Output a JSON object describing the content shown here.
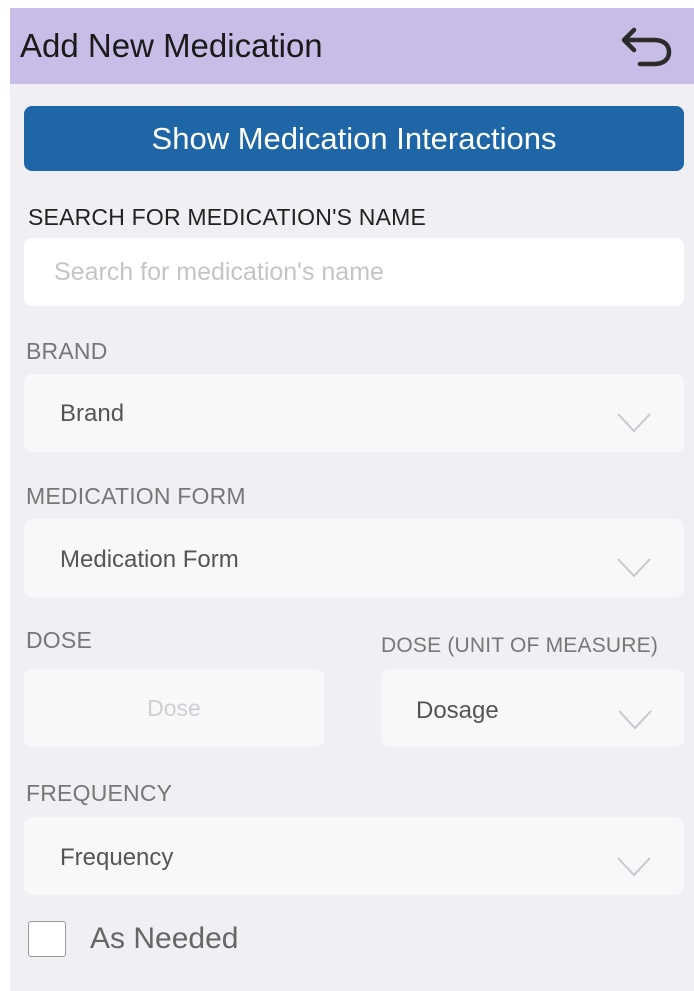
{
  "header": {
    "title": "Add New Medication",
    "back_icon": "undo-arrow-icon"
  },
  "interactions_button": {
    "label": "Show Medication Interactions"
  },
  "search": {
    "label": "SEARCH FOR MEDICATION'S NAME",
    "placeholder": "Search for medication's name",
    "value": ""
  },
  "brand": {
    "label": "BRAND",
    "value": "Brand"
  },
  "form": {
    "label": "MEDICATION FORM",
    "value": "Medication Form"
  },
  "dose": {
    "label": "DOSE",
    "placeholder": "Dose"
  },
  "dose_unit": {
    "label": "DOSE (UNIT OF MEASURE)",
    "value": "Dosage"
  },
  "frequency": {
    "label": "FREQUENCY",
    "value": "Frequency"
  },
  "as_needed": {
    "label": "As Needed",
    "checked": false
  },
  "colors": {
    "header_bg": "#c8bde6",
    "button_bg": "#1e66a6",
    "page_bg": "#efeff4"
  }
}
